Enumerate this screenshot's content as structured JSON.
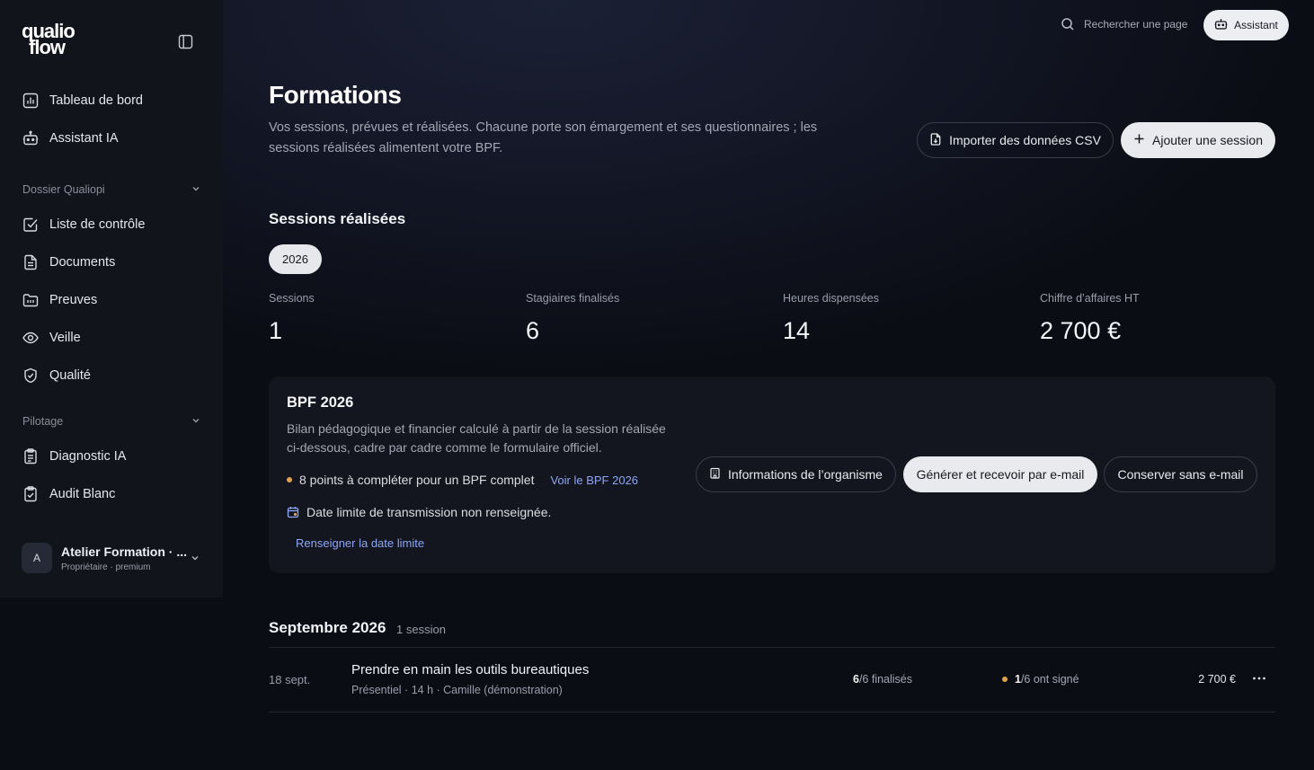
{
  "brand": {
    "line1": "qualio",
    "line2": "flow"
  },
  "sidebar": {
    "main_items": [
      {
        "label": "Tableau de bord",
        "icon": "chart-icon"
      },
      {
        "label": "Assistant IA",
        "icon": "robot-icon"
      }
    ],
    "sections": [
      {
        "title": "Dossier Qualiopi",
        "items": [
          {
            "label": "Liste de contrôle",
            "icon": "checkbox-icon"
          },
          {
            "label": "Documents",
            "icon": "document-icon"
          },
          {
            "label": "Preuves",
            "icon": "folder-icon"
          },
          {
            "label": "Veille",
            "icon": "eye-icon"
          },
          {
            "label": "Qualité",
            "icon": "shield-check-icon"
          }
        ]
      },
      {
        "title": "Pilotage",
        "items": [
          {
            "label": "Diagnostic IA",
            "icon": "clipboard-icon"
          },
          {
            "label": "Audit Blanc",
            "icon": "clipboard-check-icon"
          }
        ]
      }
    ],
    "org": {
      "initial": "A",
      "name": "Atelier Formation · ...",
      "role": "Propriétaire · premium"
    }
  },
  "topbar": {
    "search_label": "Rechercher une page",
    "assistant_label": "Assistant"
  },
  "header": {
    "title": "Formations",
    "description": "Vos sessions, prévues et réalisées. Chacune porte son émargement et ses questionnaires ; les sessions réalisées alimentent votre BPF.",
    "import_label": "Importer des données CSV",
    "add_label": "Ajouter une session"
  },
  "realised": {
    "title": "Sessions réalisées",
    "year": "2026",
    "stats": [
      {
        "label": "Sessions",
        "value": "1"
      },
      {
        "label": "Stagiaires finalisés",
        "value": "6"
      },
      {
        "label": "Heures dispensées",
        "value": "14"
      },
      {
        "label": "Chiffre d’affaires HT",
        "value": "2 700 €"
      }
    ]
  },
  "bpf": {
    "title": "BPF 2026",
    "description": "Bilan pédagogique et financier calculé à partir de la session réalisée ci-dessous, cadre par cadre comme le formulaire officiel.",
    "points_text": "8 points à compléter pour un BPF complet",
    "view_link": "Voir le BPF 2026",
    "deadline_text": "Date limite de transmission non renseignée.",
    "deadline_link": "Renseigner la date limite",
    "org_info_label": "Informations de l’organisme",
    "generate_label": "Générer et recevoir par e-mail",
    "keep_label": "Conserver sans e-mail",
    "accent": "#e0a24a"
  },
  "month": {
    "title": "Septembre 2026",
    "count": "1 session",
    "sessions": [
      {
        "date": "18 sept.",
        "title": "Prendre en main les outils bureautiques",
        "meta": "Présentiel · 14 h · Camille (démonstration)",
        "finalised_num": "6",
        "finalised_rest": "/6 finalisés",
        "signed_num": "1",
        "signed_rest": "/6 ont signé",
        "amount": "2 700 €"
      }
    ]
  }
}
